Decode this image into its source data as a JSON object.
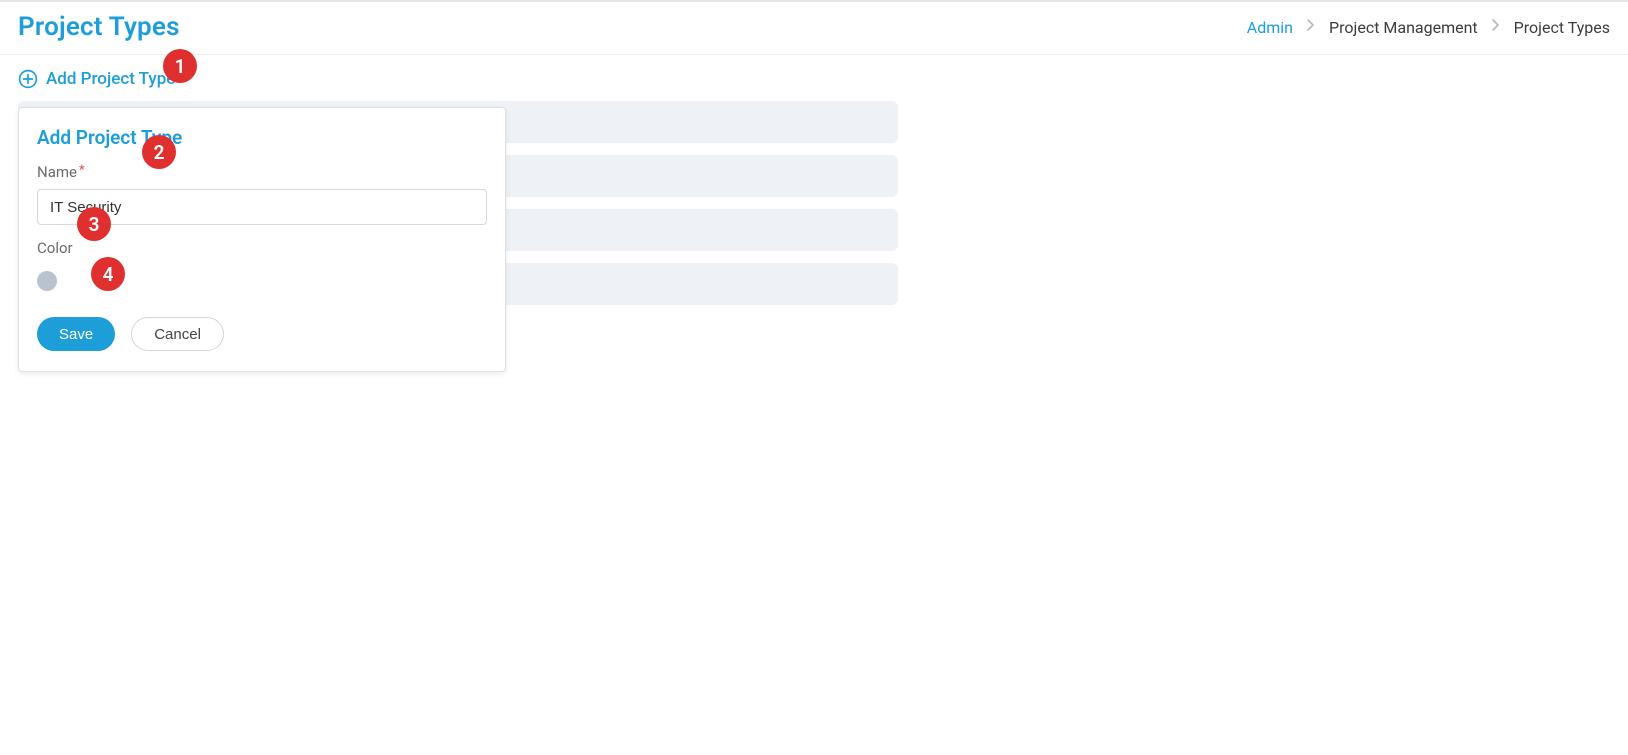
{
  "header": {
    "title": "Project Types"
  },
  "breadcrumbs": {
    "admin": "Admin",
    "project_management": "Project Management",
    "project_types": "Project Types"
  },
  "add_link": {
    "label": "Add Project Type"
  },
  "card": {
    "title": "Add Project Type",
    "name_label": "Name",
    "name_value": "IT Security",
    "color_label": "Color",
    "color_value": "#b9c3cf",
    "save_label": "Save",
    "cancel_label": "Cancel"
  },
  "steps": {
    "s1": "1",
    "s2": "2",
    "s3": "3",
    "s4": "4"
  }
}
